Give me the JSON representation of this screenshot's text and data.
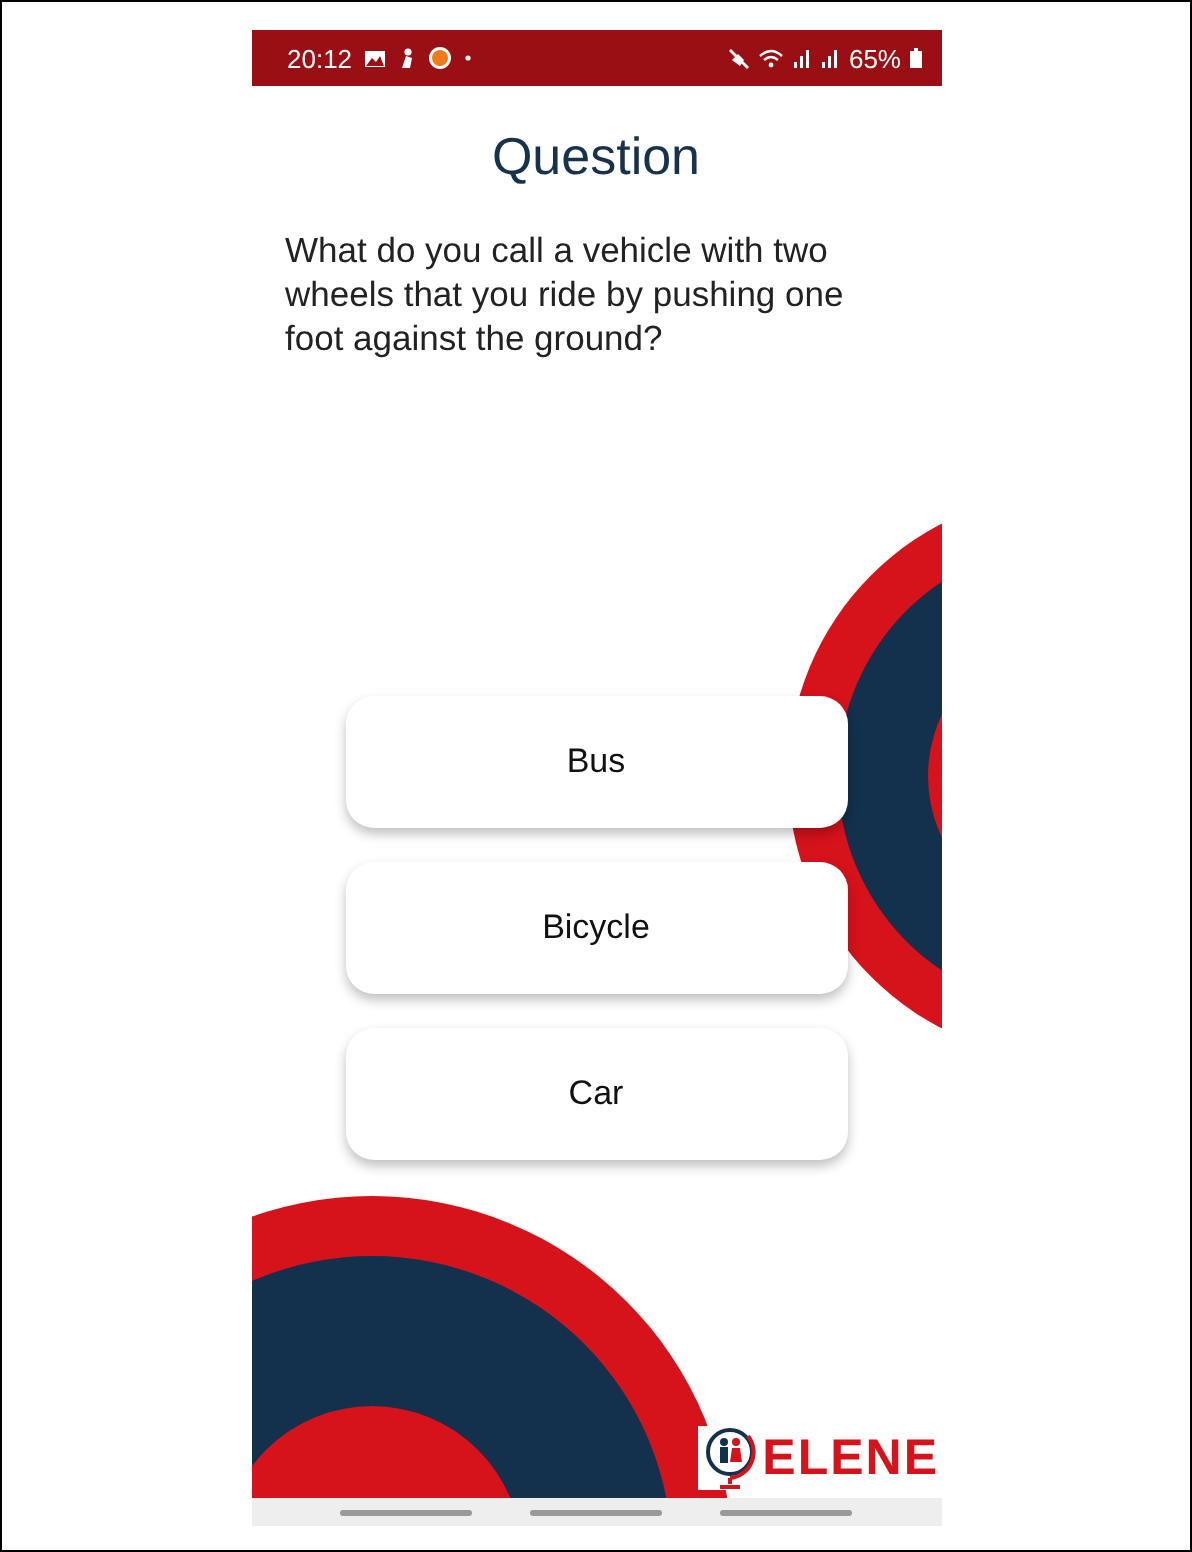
{
  "status_bar": {
    "time": "20:12",
    "battery": "65%"
  },
  "title": "Question",
  "question": "What do you call a vehicle with two wheels that you ride by pushing one foot against the ground?",
  "answers": [
    {
      "label": "Bus"
    },
    {
      "label": "Bicycle"
    },
    {
      "label": "Car"
    }
  ],
  "logo": {
    "text": "ELENE"
  }
}
